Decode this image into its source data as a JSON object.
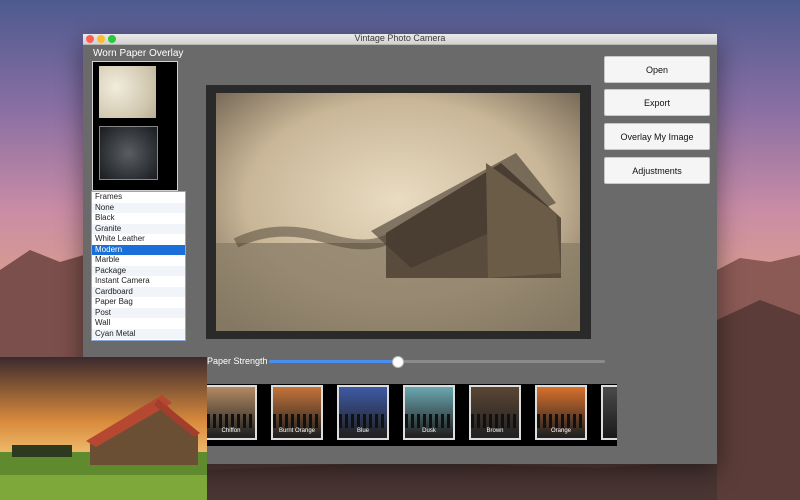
{
  "window": {
    "title": "Vintage Photo Camera"
  },
  "overlay_panel": {
    "label": "Worn Paper Overlay"
  },
  "frames": {
    "items": [
      "Frames",
      "None",
      "Black",
      "Granite",
      "White Leather",
      "Modern",
      "Marble",
      "Package",
      "Instant Camera",
      "Cardboard",
      "Paper Bag",
      "Post",
      "Wall",
      "Cyan Metal"
    ],
    "selected": "Modern"
  },
  "buttons": {
    "open": "Open",
    "export": "Export",
    "overlay": "Overlay My Image",
    "adjustments": "Adjustments"
  },
  "strength": {
    "label": "Paper Strength",
    "value": 0.38
  },
  "filters": [
    {
      "label": "Chiffon",
      "color": "#b48a63"
    },
    {
      "label": "Burnt Orange",
      "color": "#c5743a"
    },
    {
      "label": "Blue",
      "color": "#3e5aa8"
    },
    {
      "label": "Dusk",
      "color": "#6aa7b0"
    },
    {
      "label": "Brown",
      "color": "#5b4634"
    },
    {
      "label": "Orange",
      "color": "#d9702b"
    }
  ],
  "colors": {
    "accent": "#1a6fd8",
    "slider": "#4a8ff0"
  }
}
